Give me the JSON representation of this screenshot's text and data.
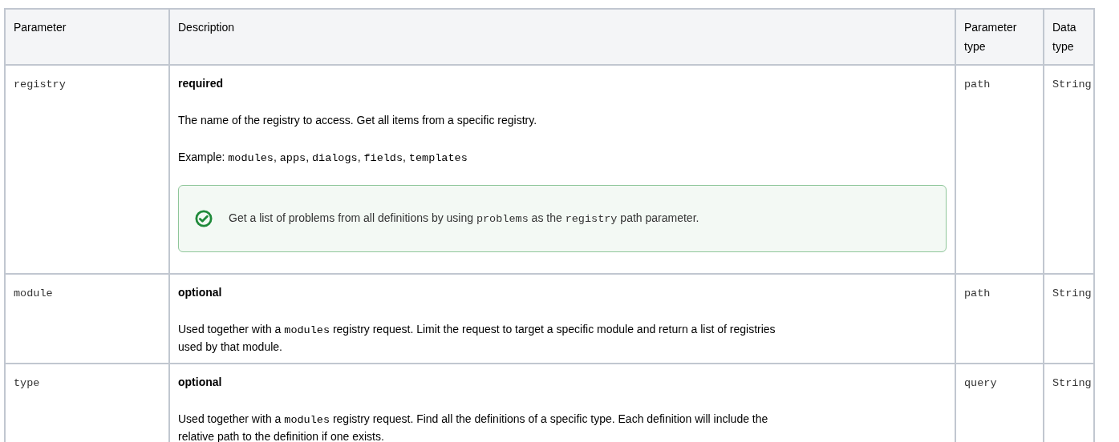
{
  "table": {
    "columns": [
      "Parameter",
      "Description",
      "Parameter type",
      "Data type"
    ],
    "rows": [
      {
        "parameter": "registry",
        "requirement": "required",
        "paragraphs": [
          [
            {
              "kind": "text",
              "text": "The name of the registry to access. Get all items from a specific registry."
            }
          ],
          [
            {
              "kind": "text",
              "text": "Example: "
            },
            {
              "kind": "code",
              "text": "modules"
            },
            {
              "kind": "text",
              "text": ", "
            },
            {
              "kind": "code",
              "text": "apps"
            },
            {
              "kind": "text",
              "text": ", "
            },
            {
              "kind": "code",
              "text": "dialogs"
            },
            {
              "kind": "text",
              "text": ", "
            },
            {
              "kind": "code",
              "text": "fields"
            },
            {
              "kind": "text",
              "text": ", "
            },
            {
              "kind": "code",
              "text": "templates"
            }
          ]
        ],
        "note": [
          {
            "kind": "text",
            "text": "Get a list of problems from all definitions by using "
          },
          {
            "kind": "code",
            "text": "problems"
          },
          {
            "kind": "text",
            "text": " as the "
          },
          {
            "kind": "code",
            "text": "registry"
          },
          {
            "kind": "text",
            "text": " path parameter."
          }
        ],
        "parameter_type": "path",
        "data_type": "String"
      },
      {
        "parameter": "module",
        "requirement": "optional",
        "paragraphs": [
          [
            {
              "kind": "text",
              "text": "Used together with a "
            },
            {
              "kind": "code",
              "text": "modules"
            },
            {
              "kind": "text",
              "text": " registry request. Limit the request to target a specific module and return a list of registries used by that module."
            }
          ]
        ],
        "parameter_type": "path",
        "data_type": "String"
      },
      {
        "parameter": "type",
        "requirement": "optional",
        "paragraphs": [
          [
            {
              "kind": "text",
              "text": "Used together with a "
            },
            {
              "kind": "code",
              "text": "modules"
            },
            {
              "kind": "text",
              "text": " registry request. Find all the definitions of a specific type. Each definition will include the relative path to the definition if one exists."
            }
          ]
        ],
        "parameter_type": "query",
        "data_type": "String"
      }
    ]
  }
}
